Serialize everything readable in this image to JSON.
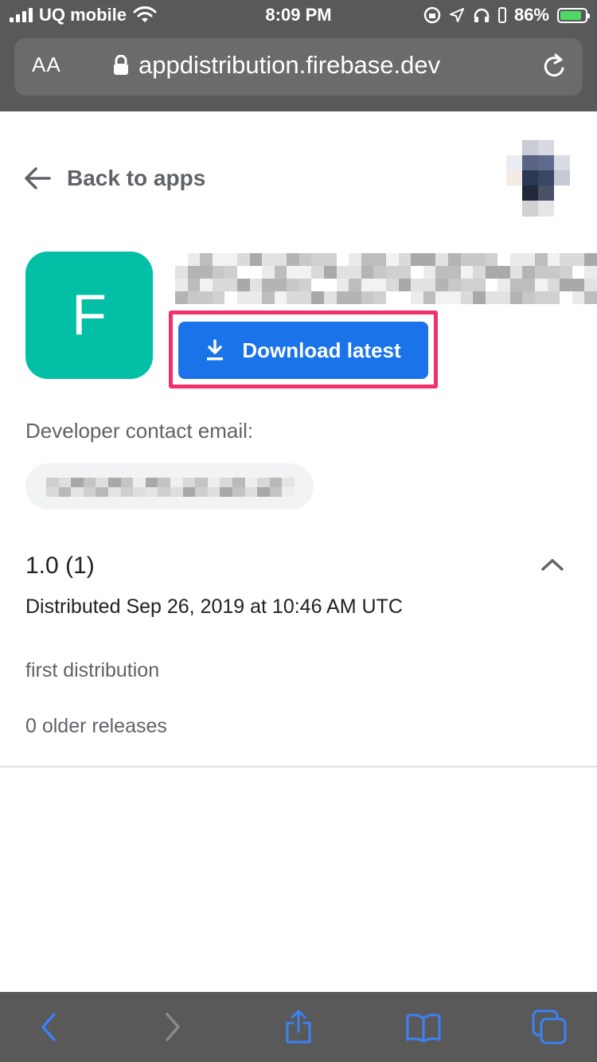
{
  "status_bar": {
    "carrier": "UQ mobile",
    "time": "8:09 PM",
    "battery_percent": "86%",
    "battery_level": 0.86
  },
  "url_bar": {
    "reader_label": "AA",
    "url": "appdistribution.firebase.dev"
  },
  "page": {
    "back_label": "Back to apps",
    "app_icon_letter": "F",
    "download_label": "Download latest",
    "contact_label": "Developer contact email:",
    "version": "1.0 (1)",
    "distributed": "Distributed Sep 26, 2019 at 10:46 AM UTC",
    "release_notes": "first distribution",
    "older_releases": "0 older releases"
  },
  "colors": {
    "app_icon": "#02bfa5",
    "download_button": "#1a73e8",
    "highlight_border": "#f2316a",
    "browser_chrome": "#595959",
    "toolbar_icons": "#3a82f7"
  },
  "icons": {
    "back": "arrow-left-icon",
    "download": "download-icon",
    "collapse": "chevron-up-icon",
    "lock": "lock-icon",
    "reload": "reload-icon",
    "toolbar": [
      "chevron-left-icon",
      "chevron-right-icon",
      "share-icon",
      "bookmarks-icon",
      "tabs-icon"
    ]
  }
}
